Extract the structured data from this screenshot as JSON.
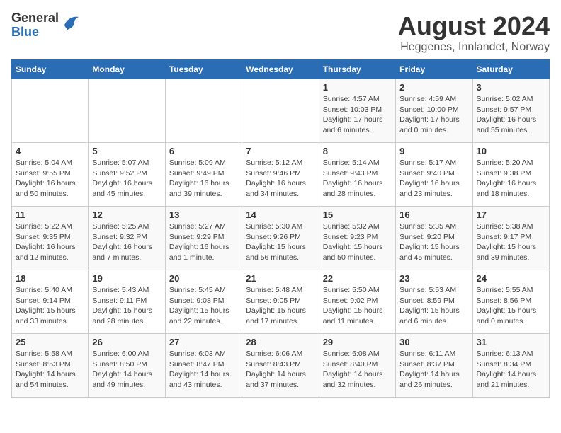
{
  "logo": {
    "general": "General",
    "blue": "Blue"
  },
  "title": "August 2024",
  "subtitle": "Heggenes, Innlandet, Norway",
  "days_of_week": [
    "Sunday",
    "Monday",
    "Tuesday",
    "Wednesday",
    "Thursday",
    "Friday",
    "Saturday"
  ],
  "weeks": [
    [
      {
        "day": "",
        "detail": ""
      },
      {
        "day": "",
        "detail": ""
      },
      {
        "day": "",
        "detail": ""
      },
      {
        "day": "",
        "detail": ""
      },
      {
        "day": "1",
        "detail": "Sunrise: 4:57 AM\nSunset: 10:03 PM\nDaylight: 17 hours\nand 6 minutes."
      },
      {
        "day": "2",
        "detail": "Sunrise: 4:59 AM\nSunset: 10:00 PM\nDaylight: 17 hours\nand 0 minutes."
      },
      {
        "day": "3",
        "detail": "Sunrise: 5:02 AM\nSunset: 9:57 PM\nDaylight: 16 hours\nand 55 minutes."
      }
    ],
    [
      {
        "day": "4",
        "detail": "Sunrise: 5:04 AM\nSunset: 9:55 PM\nDaylight: 16 hours\nand 50 minutes."
      },
      {
        "day": "5",
        "detail": "Sunrise: 5:07 AM\nSunset: 9:52 PM\nDaylight: 16 hours\nand 45 minutes."
      },
      {
        "day": "6",
        "detail": "Sunrise: 5:09 AM\nSunset: 9:49 PM\nDaylight: 16 hours\nand 39 minutes."
      },
      {
        "day": "7",
        "detail": "Sunrise: 5:12 AM\nSunset: 9:46 PM\nDaylight: 16 hours\nand 34 minutes."
      },
      {
        "day": "8",
        "detail": "Sunrise: 5:14 AM\nSunset: 9:43 PM\nDaylight: 16 hours\nand 28 minutes."
      },
      {
        "day": "9",
        "detail": "Sunrise: 5:17 AM\nSunset: 9:40 PM\nDaylight: 16 hours\nand 23 minutes."
      },
      {
        "day": "10",
        "detail": "Sunrise: 5:20 AM\nSunset: 9:38 PM\nDaylight: 16 hours\nand 18 minutes."
      }
    ],
    [
      {
        "day": "11",
        "detail": "Sunrise: 5:22 AM\nSunset: 9:35 PM\nDaylight: 16 hours\nand 12 minutes."
      },
      {
        "day": "12",
        "detail": "Sunrise: 5:25 AM\nSunset: 9:32 PM\nDaylight: 16 hours\nand 7 minutes."
      },
      {
        "day": "13",
        "detail": "Sunrise: 5:27 AM\nSunset: 9:29 PM\nDaylight: 16 hours\nand 1 minute."
      },
      {
        "day": "14",
        "detail": "Sunrise: 5:30 AM\nSunset: 9:26 PM\nDaylight: 15 hours\nand 56 minutes."
      },
      {
        "day": "15",
        "detail": "Sunrise: 5:32 AM\nSunset: 9:23 PM\nDaylight: 15 hours\nand 50 minutes."
      },
      {
        "day": "16",
        "detail": "Sunrise: 5:35 AM\nSunset: 9:20 PM\nDaylight: 15 hours\nand 45 minutes."
      },
      {
        "day": "17",
        "detail": "Sunrise: 5:38 AM\nSunset: 9:17 PM\nDaylight: 15 hours\nand 39 minutes."
      }
    ],
    [
      {
        "day": "18",
        "detail": "Sunrise: 5:40 AM\nSunset: 9:14 PM\nDaylight: 15 hours\nand 33 minutes."
      },
      {
        "day": "19",
        "detail": "Sunrise: 5:43 AM\nSunset: 9:11 PM\nDaylight: 15 hours\nand 28 minutes."
      },
      {
        "day": "20",
        "detail": "Sunrise: 5:45 AM\nSunset: 9:08 PM\nDaylight: 15 hours\nand 22 minutes."
      },
      {
        "day": "21",
        "detail": "Sunrise: 5:48 AM\nSunset: 9:05 PM\nDaylight: 15 hours\nand 17 minutes."
      },
      {
        "day": "22",
        "detail": "Sunrise: 5:50 AM\nSunset: 9:02 PM\nDaylight: 15 hours\nand 11 minutes."
      },
      {
        "day": "23",
        "detail": "Sunrise: 5:53 AM\nSunset: 8:59 PM\nDaylight: 15 hours\nand 6 minutes."
      },
      {
        "day": "24",
        "detail": "Sunrise: 5:55 AM\nSunset: 8:56 PM\nDaylight: 15 hours\nand 0 minutes."
      }
    ],
    [
      {
        "day": "25",
        "detail": "Sunrise: 5:58 AM\nSunset: 8:53 PM\nDaylight: 14 hours\nand 54 minutes."
      },
      {
        "day": "26",
        "detail": "Sunrise: 6:00 AM\nSunset: 8:50 PM\nDaylight: 14 hours\nand 49 minutes."
      },
      {
        "day": "27",
        "detail": "Sunrise: 6:03 AM\nSunset: 8:47 PM\nDaylight: 14 hours\nand 43 minutes."
      },
      {
        "day": "28",
        "detail": "Sunrise: 6:06 AM\nSunset: 8:43 PM\nDaylight: 14 hours\nand 37 minutes."
      },
      {
        "day": "29",
        "detail": "Sunrise: 6:08 AM\nSunset: 8:40 PM\nDaylight: 14 hours\nand 32 minutes."
      },
      {
        "day": "30",
        "detail": "Sunrise: 6:11 AM\nSunset: 8:37 PM\nDaylight: 14 hours\nand 26 minutes."
      },
      {
        "day": "31",
        "detail": "Sunrise: 6:13 AM\nSunset: 8:34 PM\nDaylight: 14 hours\nand 21 minutes."
      }
    ]
  ]
}
